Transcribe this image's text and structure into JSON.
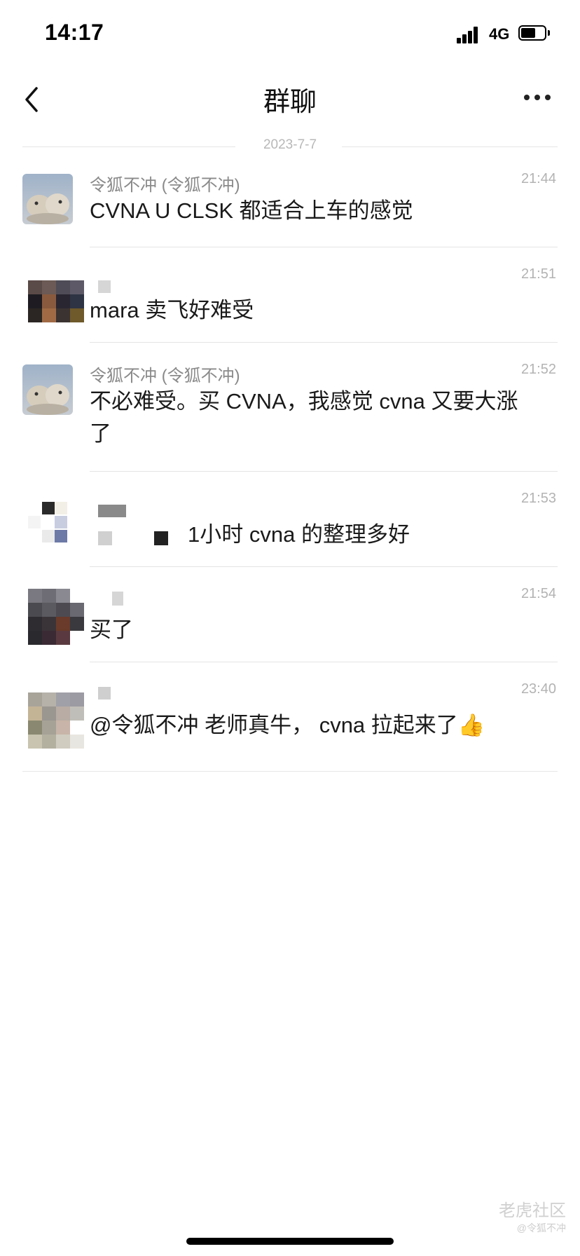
{
  "status_bar": {
    "time": "14:17",
    "network": "4G"
  },
  "header": {
    "title": "群聊"
  },
  "date_separator": "2023-7-7",
  "messages": [
    {
      "sender": "令狐不冲 (令狐不冲)",
      "time": "21:44",
      "text": "CVNA  U  CLSK  都适合上车的感觉"
    },
    {
      "sender": "",
      "time": "21:51",
      "text": "mara 卖飞好难受"
    },
    {
      "sender": "令狐不冲 (令狐不冲)",
      "time": "21:52",
      "text": "不必难受。买 CVNA，我感觉 cvna 又要大涨了"
    },
    {
      "sender": "",
      "time": "21:53",
      "text": "1小时 cvna 的整理多好"
    },
    {
      "sender": "",
      "time": "21:54",
      "text": "买了"
    },
    {
      "sender": "",
      "time": "23:40",
      "text": "@令狐不冲 老师真牛，  cvna 拉起来了👍"
    }
  ],
  "watermark": {
    "brand": "老虎社区",
    "user": "@令狐不冲"
  }
}
